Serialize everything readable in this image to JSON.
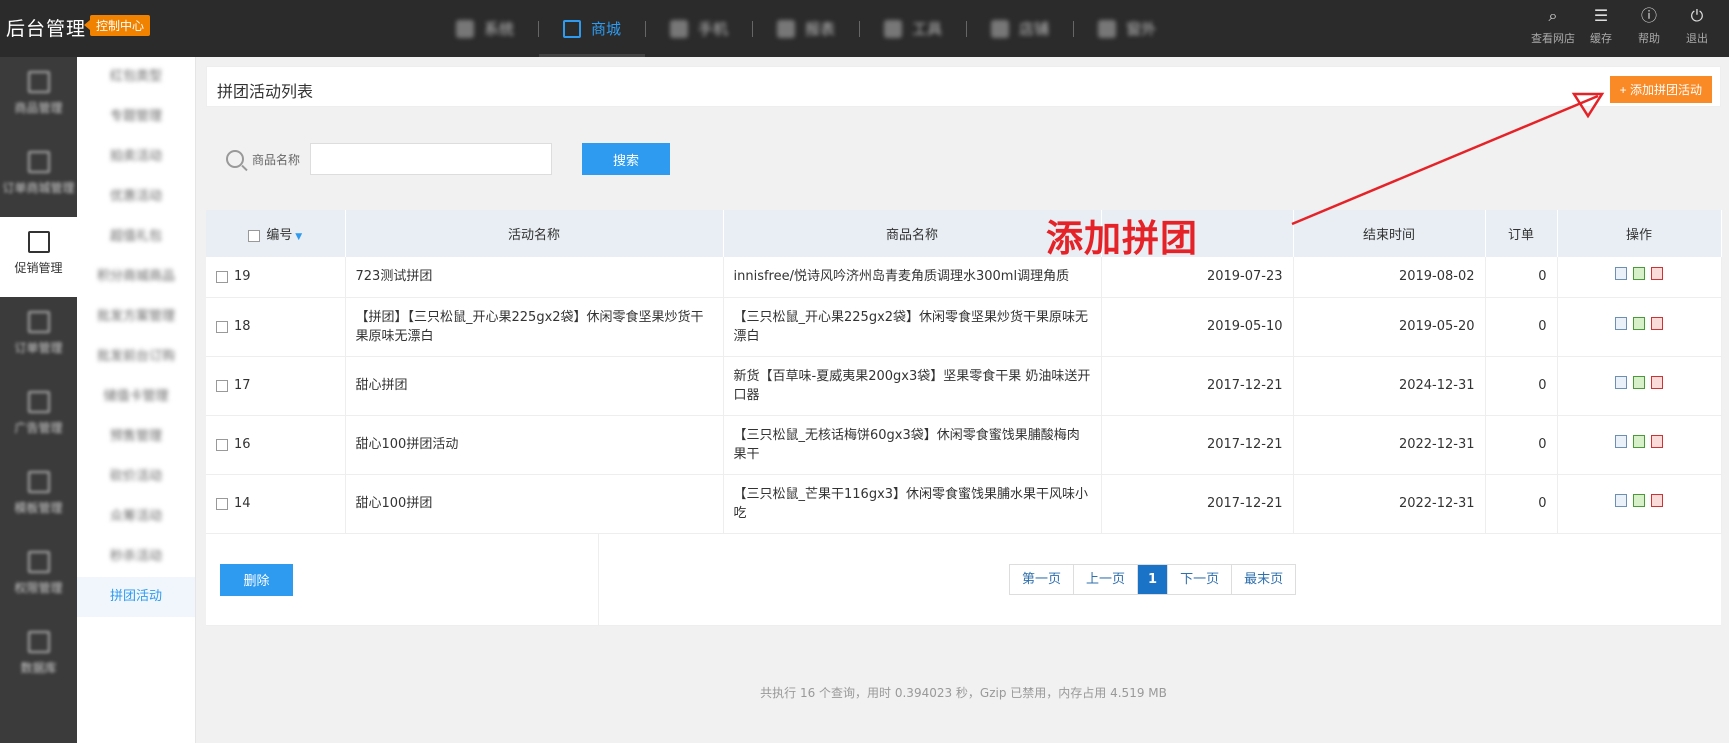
{
  "brand": {
    "title": "后台管理",
    "badge": "控制中心"
  },
  "topnav": {
    "items": [
      {
        "label": "系统"
      },
      {
        "label": "商城"
      },
      {
        "label": "手机"
      },
      {
        "label": "报表"
      },
      {
        "label": "工具"
      },
      {
        "label": "店铺"
      },
      {
        "label": "窗外"
      }
    ]
  },
  "topright": [
    {
      "label": "查看网店",
      "icon": "search-icon"
    },
    {
      "label": "缓存",
      "icon": "cache-icon"
    },
    {
      "label": "帮助",
      "icon": "help-icon"
    },
    {
      "label": "退出",
      "icon": "power-icon"
    }
  ],
  "sidebar": {
    "items": [
      {
        "label": "商品管理"
      },
      {
        "label": "订单商城管理"
      },
      {
        "label": "促销管理"
      },
      {
        "label": "订单管理"
      },
      {
        "label": "广告管理"
      },
      {
        "label": "模板管理"
      },
      {
        "label": "权限管理"
      },
      {
        "label": "数据库"
      }
    ]
  },
  "subnav": {
    "items": [
      {
        "label": "红包类型"
      },
      {
        "label": "专题管理"
      },
      {
        "label": "拍卖活动"
      },
      {
        "label": "优惠活动"
      },
      {
        "label": "超值礼包"
      },
      {
        "label": "积分商城商品"
      },
      {
        "label": "批发方案管理"
      },
      {
        "label": "批发前台订购"
      },
      {
        "label": "储值卡管理"
      },
      {
        "label": "预售管理"
      },
      {
        "label": "砍价活动"
      },
      {
        "label": "众筹活动"
      },
      {
        "label": "秒杀活动"
      },
      {
        "label": "拼团活动"
      }
    ]
  },
  "page": {
    "title": "拼团活动列表",
    "add_button": "+ 添加拼团活动"
  },
  "search": {
    "label": "商品名称",
    "value": "",
    "button": "搜索"
  },
  "table": {
    "headers": {
      "id": "编号",
      "name": "活动名称",
      "goods": "商品名称",
      "start": "",
      "end": "结束时间",
      "orders": "订单",
      "ops": "操作"
    },
    "rows": [
      {
        "id": "19",
        "name": "723测试拼团",
        "goods": "innisfree/悦诗风吟济州岛青麦角质调理水300ml调理角质",
        "start": "2019-07-23",
        "end": "2019-08-02",
        "orders": "0"
      },
      {
        "id": "18",
        "name": "【拼团】【三只松鼠_开心果225gx2袋】休闲零食坚果炒货干果原味无漂白",
        "goods": "【三只松鼠_开心果225gx2袋】休闲零食坚果炒货干果原味无漂白",
        "start": "2019-05-10",
        "end": "2019-05-20",
        "orders": "0"
      },
      {
        "id": "17",
        "name": "甜心拼团",
        "goods": "新货【百草味-夏威夷果200gx3袋】坚果零食干果 奶油味送开口器",
        "start": "2017-12-21",
        "end": "2024-12-31",
        "orders": "0"
      },
      {
        "id": "16",
        "name": "甜心100拼团活动",
        "goods": "【三只松鼠_无核话梅饼60gx3袋】休闲零食蜜饯果脯酸梅肉果干",
        "start": "2017-12-21",
        "end": "2022-12-31",
        "orders": "0"
      },
      {
        "id": "14",
        "name": "甜心100拼团",
        "goods": "【三只松鼠_芒果干116gx3】休闲零食蜜饯果脯水果干风味小吃",
        "start": "2017-12-21",
        "end": "2022-12-31",
        "orders": "0"
      }
    ]
  },
  "footer": {
    "delete_button": "删除",
    "pager": [
      "第一页",
      "上一页",
      "1",
      "下一页",
      "最末页"
    ]
  },
  "stats": "共执行 16 个查询，用时 0.394023 秒，Gzip 已禁用，内存占用 4.519 MB",
  "annotation": "添加拼团"
}
